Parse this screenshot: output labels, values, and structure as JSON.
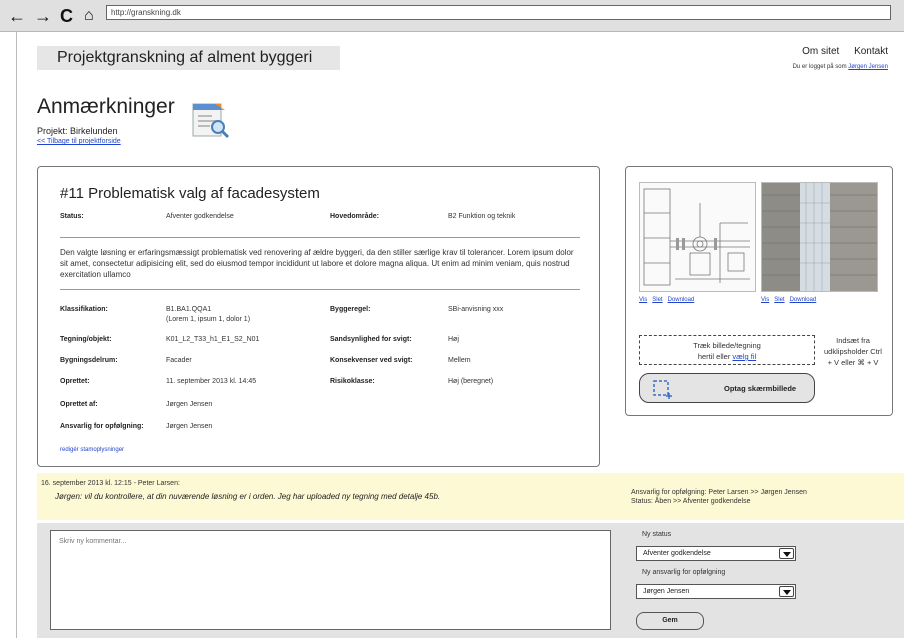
{
  "browser": {
    "back_icon": "←",
    "forward_icon": "→",
    "reload_icon": "C",
    "home_icon": "⌂",
    "url": "http://granskning.dk"
  },
  "header": {
    "site_title": "Projektgranskning af alment byggeri",
    "nav": [
      "Om sitet",
      "Kontakt"
    ],
    "logged_in_prefix": "Du er logget på som",
    "user": "Jørgen Jensen"
  },
  "page": {
    "title": "Anmærkninger",
    "project": "Projekt: Birkelunden",
    "back_link": "<< Tilbage til projektforside"
  },
  "issue": {
    "title": "#11  Problematisk valg af facadesystem",
    "status_label": "Status:",
    "status_value": "Afventer godkendelse",
    "area_label": "Hovedområde:",
    "area_value": "B2 Funktion og teknik",
    "description": "Den valgte løsning er erfaringsmæssigt problematisk ved renovering af ældre byggeri, da den stiller særlige krav til tolerancer. Lorem ipsum dolor sit amet, consectetur adipisicing elit, sed do eiusmod tempor incididunt ut labore et dolore magna aliqua. Ut enim ad minim veniam, quis nostrud exercitation ullamco",
    "left_fields": [
      {
        "label": "Klassifikation:",
        "value": "B1.BA1.QQA1",
        "sub": "(Lorem 1, ipsum 1, dolor 1)"
      },
      {
        "label": "Tegning/objekt:",
        "value": "K01_L2_T33_h1_E1_S2_N01"
      },
      {
        "label": "Bygningsdelrum:",
        "value": "Facader"
      },
      {
        "label": "Oprettet:",
        "value": "11. september 2013 kl. 14:45"
      },
      {
        "label": "Oprettet af:",
        "value": "Jørgen Jensen"
      },
      {
        "label": "Ansvarlig for opfølgning:",
        "value": "Jørgen Jensen"
      }
    ],
    "right_fields": [
      {
        "label": "Byggeregel:",
        "value": "SBi-anvisning xxx"
      },
      {
        "label": "Sandsynlighed for svigt:",
        "value": "Høj"
      },
      {
        "label": "Konsekvenser ved svigt:",
        "value": "Mellem"
      },
      {
        "label": "Risikoklasse:",
        "value": "Høj (beregnet)"
      }
    ],
    "edit_link": "redigér stamoplysninger"
  },
  "images": {
    "links": [
      "Vis",
      "Slet",
      "Download"
    ],
    "drop_text": "Træk billede/tegning",
    "drop_text2": "hertil eller",
    "drop_link": "vælg fil",
    "paste_hint": "Indsæt fra udklipsholder Ctrl + V eller ⌘ + V",
    "capture_label": "Optag skærmbillede",
    "capture_icon": "screenshot-icon"
  },
  "comment": {
    "meta": "16. september 2013 kl. 12:15 - Peter Larsen:",
    "text": "Jørgen: vil du kontrollere, at din nuværende løsning er i orden. Jeg har uploaded ny tegning med detalje 45b.",
    "change_1": "Ansvarlig for opfølgning: Peter Larsen >> Jørgen Jensen",
    "change_2": "Status: Åben >> Afventer godkendelse"
  },
  "new_comment": {
    "placeholder": "Skriv ny kommentar...",
    "status_label": "Ny status",
    "status_value": "Afventer godkendelse",
    "responsible_label": "Ny ansvarlig for opfølgning",
    "responsible_value": "Jørgen Jensen",
    "save_label": "Gem"
  }
}
